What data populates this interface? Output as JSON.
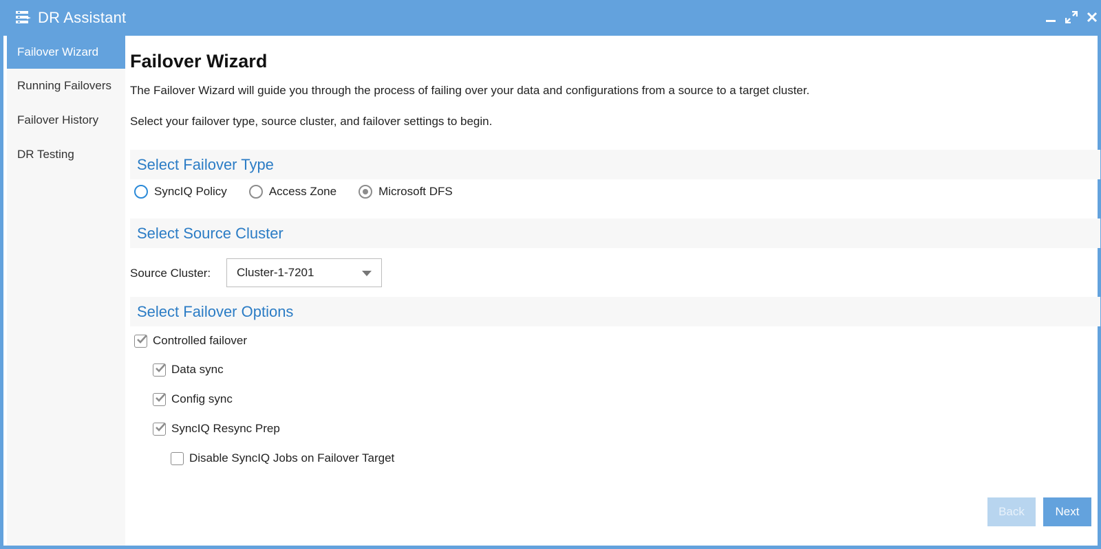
{
  "window": {
    "title": "DR Assistant"
  },
  "sidebar": {
    "items": [
      {
        "label": "Failover Wizard",
        "active": true
      },
      {
        "label": "Running Failovers",
        "active": false
      },
      {
        "label": "Failover History",
        "active": false
      },
      {
        "label": "DR Testing",
        "active": false
      }
    ]
  },
  "main": {
    "title": "Failover Wizard",
    "description_1": "The Failover Wizard will guide you through the process of failing over your data and configurations from a source to a target cluster.",
    "description_2": "Select your failover type, source cluster, and failover settings to begin.",
    "failover_type": {
      "heading": "Select Failover Type",
      "options": [
        {
          "label": "SyncIQ Policy",
          "selected": false,
          "focused": true
        },
        {
          "label": "Access Zone",
          "selected": false,
          "focused": false
        },
        {
          "label": "Microsoft DFS",
          "selected": true,
          "focused": false
        }
      ]
    },
    "source_cluster": {
      "heading": "Select Source Cluster",
      "label": "Source Cluster:",
      "value": "Cluster-1-7201"
    },
    "failover_options": {
      "heading": "Select Failover Options",
      "controlled_failover": {
        "label": "Controlled failover",
        "checked": true
      },
      "data_sync": {
        "label": "Data sync",
        "checked": true
      },
      "config_sync": {
        "label": "Config sync",
        "checked": true
      },
      "resync_prep": {
        "label": "SyncIQ Resync Prep",
        "checked": true
      },
      "disable_jobs": {
        "label": "Disable SyncIQ Jobs on Failover Target",
        "checked": false
      }
    }
  },
  "footer": {
    "back_label": "Back",
    "next_label": "Next"
  },
  "colors": {
    "accent": "#63a2dd",
    "heading_blue": "#2b7cc5",
    "section_bg": "#f7f7f7"
  }
}
